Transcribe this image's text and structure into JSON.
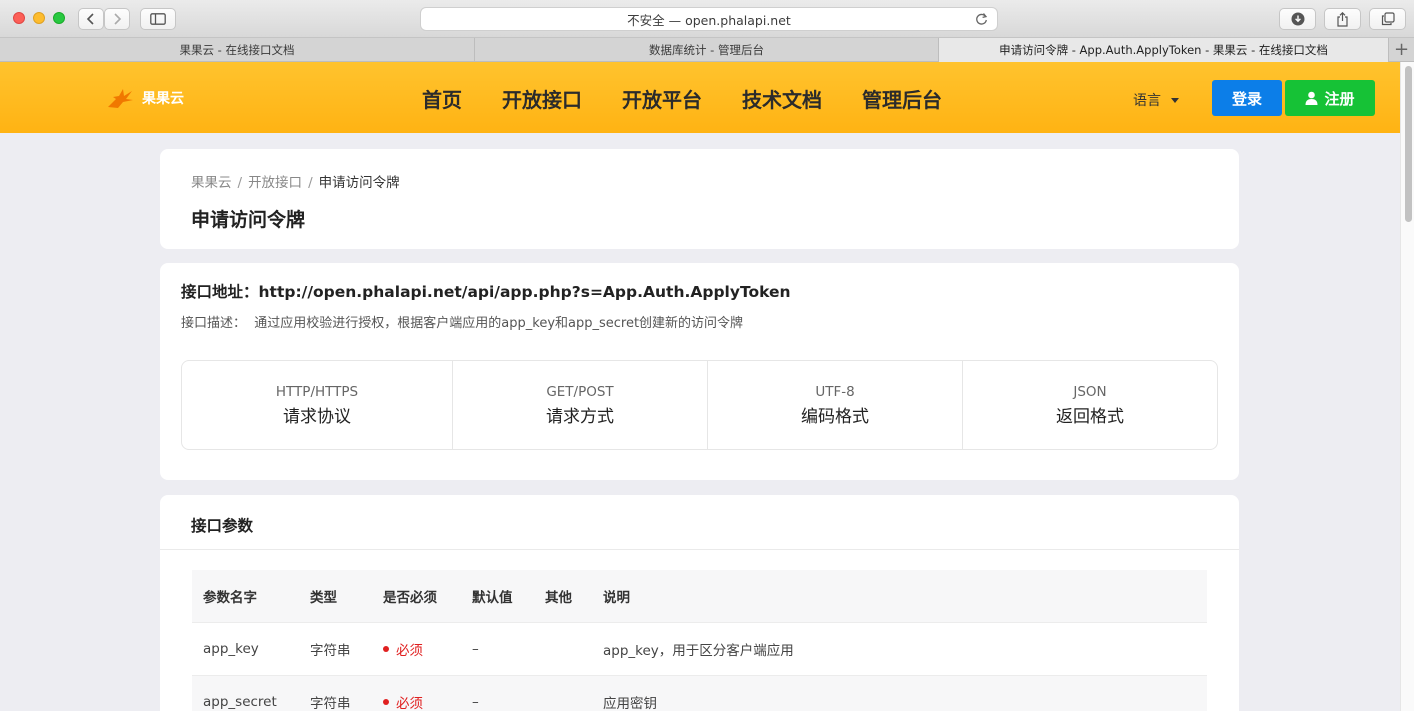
{
  "browser": {
    "address": "不安全 — open.phalapi.net",
    "tabs": [
      {
        "label": "果果云 - 在线接口文档"
      },
      {
        "label": "数据库统计 - 管理后台"
      },
      {
        "label": "申请访问令牌 - App.Auth.ApplyToken - 果果云 - 在线接口文档"
      }
    ]
  },
  "header": {
    "logo_text": "果果云",
    "nav": [
      "首页",
      "开放接口",
      "开放平台",
      "技术文档",
      "管理后台"
    ],
    "language": "语言",
    "login": "登录",
    "register": "注册"
  },
  "breadcrumb": {
    "home": "果果云",
    "section": "开放接口",
    "current": "申请访问令牌"
  },
  "page_title": "申请访问令牌",
  "api": {
    "url_label": "接口地址：",
    "url": "http://open.phalapi.net/api/app.php?s=App.Auth.ApplyToken",
    "desc_label": "接口描述：",
    "desc": "通过应用校验进行授权，根据客户端应用的app_key和app_secret创建新的访问令牌",
    "info": [
      {
        "value": "HTTP/HTTPS",
        "label": "请求协议"
      },
      {
        "value": "GET/POST",
        "label": "请求方式"
      },
      {
        "value": "UTF-8",
        "label": "编码格式"
      },
      {
        "value": "JSON",
        "label": "返回格式"
      }
    ]
  },
  "params": {
    "title": "接口参数",
    "columns": [
      "参数名字",
      "类型",
      "是否必须",
      "默认值",
      "其他",
      "说明"
    ],
    "rows": [
      {
        "name": "app_key",
        "type": "字符串",
        "required": "必须",
        "default": "–",
        "other": "",
        "desc": "app_key，用于区分客户端应用"
      },
      {
        "name": "app_secret",
        "type": "字符串",
        "required": "必须",
        "default": "–",
        "other": "",
        "desc": "应用密钥"
      }
    ]
  },
  "colors": {
    "header": "#ffb313",
    "login": "#0c7ee8",
    "register": "#16c236",
    "required": "#e02020"
  }
}
